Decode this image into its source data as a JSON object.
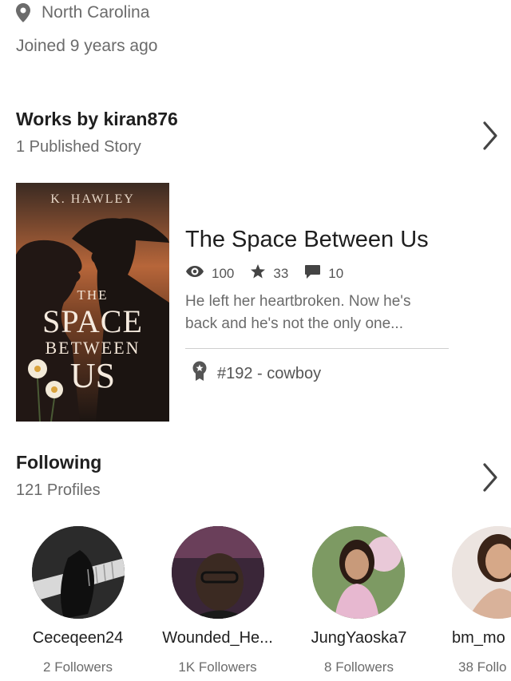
{
  "profile": {
    "location": "North Carolina",
    "joined": "Joined 9 years ago"
  },
  "works": {
    "title": "Works by kiran876",
    "subtitle": "1 Published Story",
    "story": {
      "cover_author": "K. HAWLEY",
      "cover_line1": "THE",
      "cover_line2": "SPACE",
      "cover_line3": "BETWEEN",
      "cover_line4": "US",
      "title": "The Space Between Us",
      "reads": "100",
      "votes": "33",
      "comments": "10",
      "description_line1": "He left her heartbroken. Now he's",
      "description_line2": "back and he's not the only one...",
      "ranking": "#192 - cowboy"
    }
  },
  "following": {
    "title": "Following",
    "subtitle": "121 Profiles",
    "profiles": [
      {
        "name": "Ceceqeen24",
        "followers": "2 Followers"
      },
      {
        "name": "Wounded_He...",
        "followers": "1K Followers"
      },
      {
        "name": "JungYaoska7",
        "followers": "8 Followers"
      },
      {
        "name": "bm_mo",
        "followers": "38 Follo"
      }
    ]
  },
  "colors": {
    "text_primary": "#1e1e1e",
    "text_secondary": "#6b6b6b",
    "icon": "#555555",
    "divider": "#cfcfcf"
  },
  "icons": {
    "location": "location-pin-icon",
    "reads": "eye-icon",
    "votes": "star-icon",
    "comments": "comment-icon",
    "ranking": "award-badge-icon",
    "chevron": "chevron-right-icon"
  }
}
